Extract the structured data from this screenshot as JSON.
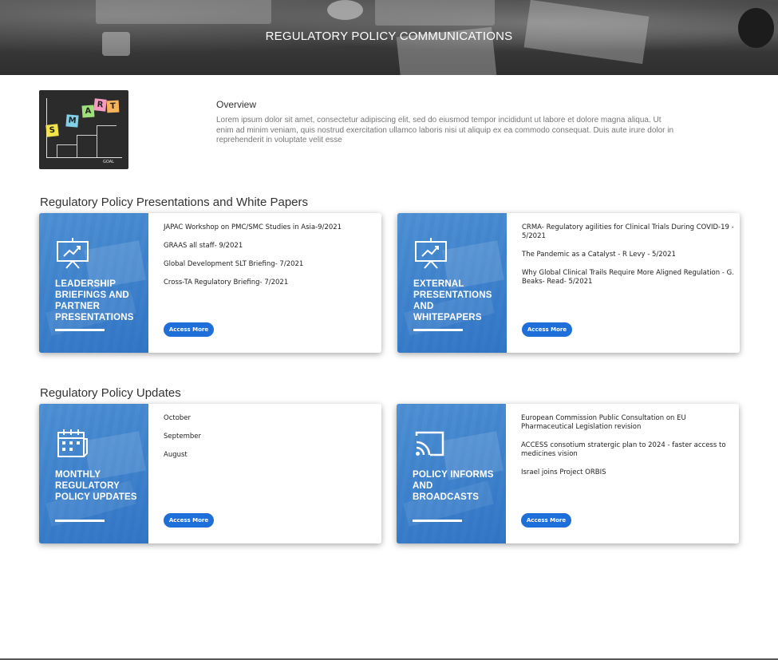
{
  "banner": {
    "title": "REGULATORY POLICY COMMUNICATIONS"
  },
  "overview": {
    "title": "Overview",
    "body": "Lorem ipsum dolor sit amet, consectetur adipiscing elit, sed do eiusmod tempor incididunt ut labore et dolore magna aliqua. Ut enim ad minim veniam, quis nostrud exercitation ullamco laboris nisi ut aliquip ex ea commodo consequat. Duis aute irure dolor in reprehenderit in voluptate velit esse",
    "image": {
      "letters": [
        "S",
        "M",
        "A",
        "R",
        "T"
      ],
      "note_colors": [
        "#f3e44b",
        "#7fd1e8",
        "#9fe07a",
        "#f59ac0",
        "#f7b35a"
      ],
      "goal_label": "GOAL"
    }
  },
  "sections": [
    {
      "title": "Regulatory Policy Presentations and White Papers",
      "cards": [
        {
          "panel_label": "LEADERSHIP BRIEFINGS AND PARTNER PRESENTATIONS",
          "icon": "presentation-chart-icon",
          "items": [
            "JAPAC Workshop on PMC/SMC Studies in Asia-9/2021",
            "GRAAS all staff- 9/2021",
            "Global Development SLT Briefing- 7/2021",
            "Cross-TA Regulatory Briefing- 7/2021"
          ],
          "button": "Access More"
        },
        {
          "panel_label": "EXTERNAL PRESENTATIONS AND WHITEPAPERS",
          "icon": "presentation-chart-icon",
          "items": [
            "CRMA- Regulatory agilities for Clinical Trials During COVID-19 - 5/2021",
            "The Pandemic as a Catalyst - R Levy - 5/2021",
            "Why Global Clinical Trails Require More Aligned Regulation - G. Beaks- Read- 5/2021"
          ],
          "button": "Access More"
        }
      ]
    },
    {
      "title": "Regulatory Policy Updates",
      "cards": [
        {
          "panel_label": "MONTHLY REGULATORY POLICY UPDATES",
          "icon": "calendar-icon",
          "items": [
            "October",
            "September",
            "August"
          ],
          "button": "Access More"
        },
        {
          "panel_label": "POLICY INFORMS AND BROADCASTS",
          "icon": "cast-icon",
          "items": [
            "European Commission Public Consultation on EU Pharmaceutical Legislation revision",
            "ACCESS consotium stratergic plan to 2024 - faster access to medicines vision",
            "Israel joins Project ORBIS"
          ],
          "button": "Access More"
        }
      ]
    }
  ],
  "colors": {
    "accent": "#1e6fd9",
    "panel_blue": "#3d86d0",
    "banner_dark": "#3a3a3a"
  }
}
